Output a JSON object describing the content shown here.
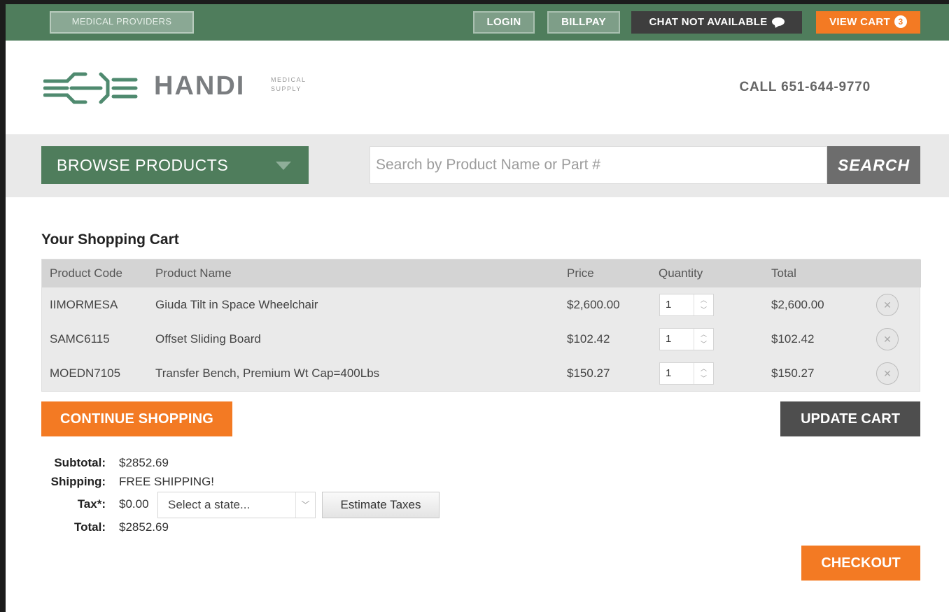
{
  "topbar": {
    "medical_providers": "MEDICAL PROVIDERS",
    "login": "LOGIN",
    "billpay": "BILLPAY",
    "chat": "CHAT NOT AVAILABLE",
    "view_cart": "VIEW CART",
    "cart_count": "3"
  },
  "header": {
    "logo_word": "HANDI",
    "logo_sub_1": "MEDICAL",
    "logo_sub_2": "SUPPLY",
    "phone": "CALL 651-644-9770"
  },
  "browse": {
    "label": "BROWSE PRODUCTS",
    "search_placeholder": "Search by Product Name or Part #",
    "search_button": "SEARCH"
  },
  "cart": {
    "title": "Your Shopping Cart",
    "columns": [
      "Product Code",
      "Product Name",
      "Price",
      "Quantity",
      "Total"
    ],
    "rows": [
      {
        "code": "IIMORMESA",
        "name": "Giuda Tilt in Space Wheelchair",
        "price": "$2,600.00",
        "qty": "1",
        "total": "$2,600.00"
      },
      {
        "code": "SAMC6115",
        "name": "Offset Sliding Board",
        "price": "$102.42",
        "qty": "1",
        "total": "$102.42"
      },
      {
        "code": "MOEDN7105",
        "name": "Transfer Bench, Premium Wt Cap=400Lbs",
        "price": "$150.27",
        "qty": "1",
        "total": "$150.27"
      }
    ],
    "continue_button": "CONTINUE SHOPPING",
    "update_button": "UPDATE CART"
  },
  "summary": {
    "subtotal_label": "Subtotal:",
    "subtotal": "$2852.69",
    "shipping_label": "Shipping:",
    "shipping": "FREE SHIPPING!",
    "tax_label": "Tax*:",
    "tax": "$0.00",
    "state_select": "Select a state...",
    "estimate_button": "Estimate Taxes",
    "total_label": "Total:",
    "total": "$2852.69"
  },
  "checkout_button": "CHECKOUT",
  "colors": {
    "green": "#4f7d5c",
    "orange": "#f37a23",
    "dark_gray": "#4e4e4e"
  }
}
